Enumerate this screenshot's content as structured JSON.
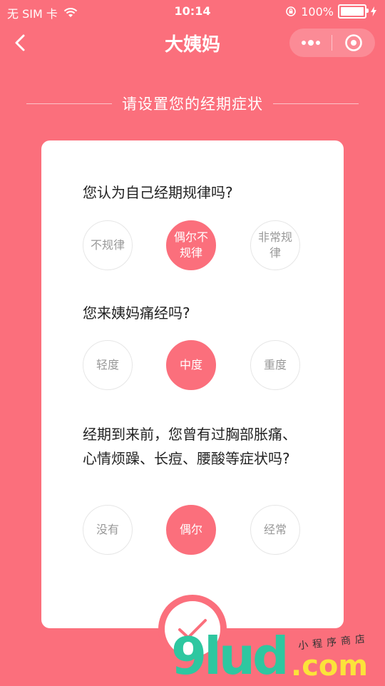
{
  "status_bar": {
    "carrier": "无 SIM 卡",
    "time": "10:14",
    "battery_percent": "100%",
    "battery_level": 1.0
  },
  "nav": {
    "title": "大姨妈"
  },
  "section_heading": "请设置您的经期症状",
  "questions": [
    {
      "text": "您认为自己经期规律吗?",
      "options": [
        "不规律",
        "偶尔不规律",
        "非常规律"
      ],
      "selected_index": 1
    },
    {
      "text": "您来姨妈痛经吗?",
      "options": [
        "轻度",
        "中度",
        "重度"
      ],
      "selected_index": 1
    },
    {
      "text": "经期到来前，您曾有过胸部胀痛、心情烦躁、长痘、腰酸等症状吗?",
      "options": [
        "没有",
        "偶尔",
        "经常"
      ],
      "selected_index": 1
    }
  ],
  "watermark": {
    "brand": "9lud",
    "domain": ".com",
    "tagline": "小程序商店"
  },
  "colors": {
    "accent": "#fb6f7c",
    "card": "#ffffff",
    "option_text": "#999999"
  }
}
